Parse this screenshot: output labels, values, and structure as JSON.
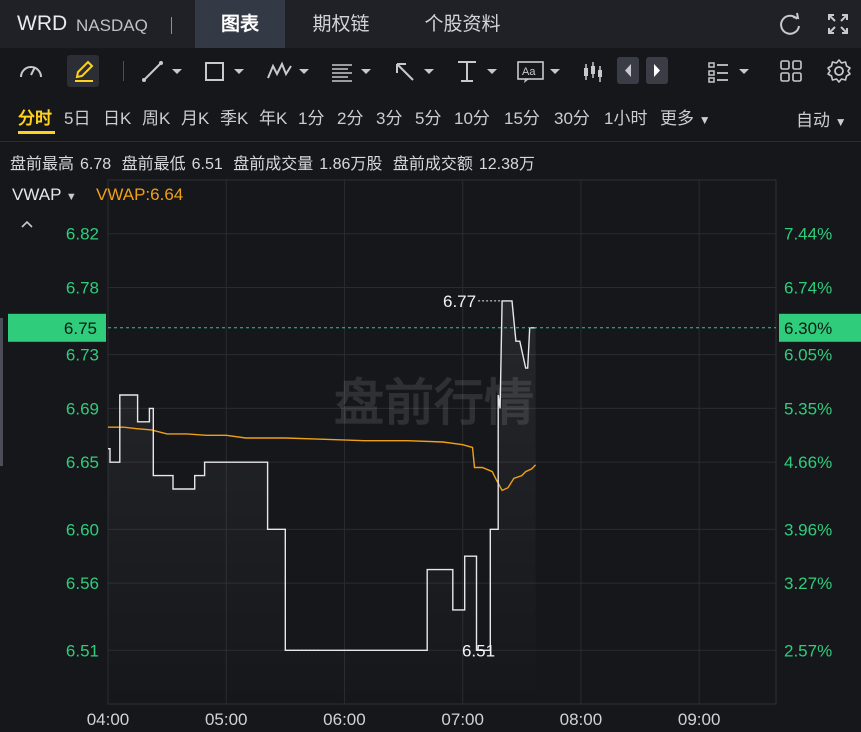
{
  "header": {
    "ticker": "WRD",
    "exchange": "NASDAQ",
    "tabs": [
      {
        "label": "图表",
        "active": true
      },
      {
        "label": "期权链",
        "active": false
      },
      {
        "label": "个股资料",
        "active": false
      }
    ],
    "icons": [
      "refresh-icon",
      "expand-icon"
    ]
  },
  "toolbar": {
    "icons": [
      "gauge-icon",
      "draw-pen-icon",
      "trend-line-icon",
      "rectangle-icon",
      "wave-pattern-icon",
      "fibonacci-icon",
      "arrow-icon",
      "vertical-measure-icon",
      "text-annotation-icon",
      "candle-style-icon",
      "prev-icon",
      "next-icon",
      "indicator-list-icon",
      "layout-grid-icon",
      "settings-icon"
    ],
    "text_tool_label": "Aa"
  },
  "periods": {
    "items": [
      "分时",
      "5日",
      "日K",
      "周K",
      "月K",
      "季K",
      "年K",
      "1分",
      "2分",
      "3分",
      "5分",
      "10分",
      "15分",
      "30分",
      "1小时",
      "更多"
    ],
    "active": "分时",
    "mode": "自动"
  },
  "stats": {
    "premarket_high_label": "盘前最高",
    "premarket_high": "6.78",
    "premarket_low_label": "盘前最低",
    "premarket_low": "6.51",
    "premarket_volume_label": "盘前成交量",
    "premarket_volume": "1.86万股",
    "premarket_turnover_label": "盘前成交额",
    "premarket_turnover": "12.38万"
  },
  "indicator": {
    "name": "VWAP",
    "value_text": "VWAP:6.64"
  },
  "colors": {
    "price_line": "#e6e7ea",
    "vwap_line": "#f0a018",
    "axis_green": "#2fcc7c",
    "current_price_bg": "#2fcc7c",
    "active_period": "#ffd21f"
  },
  "chart_data": {
    "type": "line",
    "watermark": "盘前行情",
    "current_price": "6.75",
    "current_change": "6.30%",
    "high_label": "6.77",
    "low_label": "6.51",
    "y_ticks": [
      "6.82",
      "6.78",
      "6.73",
      "6.69",
      "6.65",
      "6.60",
      "6.56",
      "6.51"
    ],
    "y_ticks_right": [
      "7.44%",
      "6.74%",
      "6.05%",
      "5.35%",
      "4.66%",
      "3.96%",
      "3.27%",
      "2.57%"
    ],
    "x_ticks": [
      "04:00",
      "05:00",
      "06:00",
      "07:00",
      "08:00",
      "09:00"
    ],
    "ylim": [
      6.47,
      6.86
    ],
    "xlim_minutes": [
      240,
      579
    ],
    "series": [
      {
        "name": "",
        "x": [
          240,
          241,
          241,
          245,
          246,
          246,
          254,
          255,
          255,
          260,
          261,
          261,
          262,
          263,
          263,
          272,
          273,
          273,
          283,
          284,
          284,
          288,
          289,
          289,
          320,
          321,
          321,
          329,
          330,
          330,
          338,
          339,
          339,
          401,
          402,
          402,
          414,
          415,
          415,
          420,
          421,
          421,
          426,
          427,
          427,
          433,
          434,
          434,
          438,
          438,
          439,
          440,
          441,
          442,
          444,
          445,
          447,
          449,
          452,
          453,
          454,
          455,
          457
        ],
        "y": [
          6.66,
          6.66,
          6.65,
          6.65,
          6.65,
          6.7,
          6.7,
          6.7,
          6.68,
          6.68,
          6.68,
          6.69,
          6.69,
          6.69,
          6.64,
          6.64,
          6.64,
          6.63,
          6.63,
          6.63,
          6.64,
          6.64,
          6.64,
          6.65,
          6.65,
          6.65,
          6.6,
          6.6,
          6.6,
          6.51,
          6.51,
          6.51,
          6.51,
          6.51,
          6.51,
          6.57,
          6.57,
          6.57,
          6.54,
          6.54,
          6.54,
          6.58,
          6.58,
          6.58,
          6.51,
          6.51,
          6.51,
          6.6,
          6.6,
          6.7,
          6.69,
          6.77,
          6.77,
          6.77,
          6.77,
          6.77,
          6.74,
          6.74,
          6.72,
          6.72,
          6.75,
          6.75,
          6.75
        ]
      },
      {
        "name": "VWAP",
        "x": [
          240,
          248,
          254,
          262,
          270,
          280,
          290,
          300,
          310,
          330,
          350,
          370,
          392,
          410,
          420,
          425,
          426,
          430,
          435,
          437,
          440,
          443,
          446,
          450,
          452,
          455,
          457
        ],
        "y": [
          6.676,
          6.676,
          6.675,
          6.674,
          6.671,
          6.671,
          6.67,
          6.67,
          6.668,
          6.668,
          6.667,
          6.666,
          6.666,
          6.665,
          6.663,
          6.661,
          6.646,
          6.646,
          6.643,
          6.637,
          6.629,
          6.631,
          6.638,
          6.64,
          6.643,
          6.645,
          6.648
        ]
      }
    ]
  }
}
